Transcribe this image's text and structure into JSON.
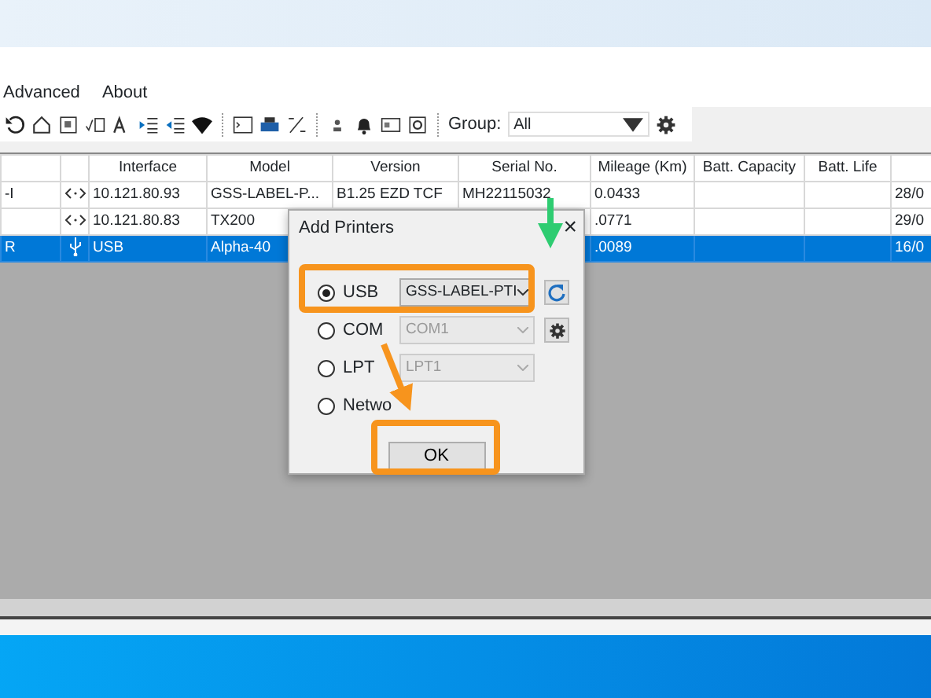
{
  "menu": [
    "Advanced",
    "About"
  ],
  "group": {
    "label": "Group:",
    "value": "All"
  },
  "table": {
    "columns": [
      "",
      "",
      "Interface",
      "Model",
      "Version",
      "Serial No.",
      "Mileage (Km)",
      "Batt. Capacity",
      "Batt. Life",
      ""
    ],
    "rows": [
      {
        "selected": false,
        "kind": "network",
        "cells": [
          "-I",
          "",
          "10.121.80.93",
          "GSS-LABEL-P...",
          "B1.25 EZD TCF",
          "MH22115032",
          "0.0433",
          "",
          "",
          "28/0"
        ]
      },
      {
        "selected": false,
        "kind": "network",
        "cells": [
          "",
          "",
          "10.121.80.83",
          "TX200",
          "",
          "",
          ".0771",
          "",
          "",
          "29/0"
        ]
      },
      {
        "selected": true,
        "kind": "usb",
        "cells": [
          "R",
          "",
          "USB",
          "Alpha-40",
          "",
          "",
          ".0089",
          "",
          "",
          "16/0"
        ]
      }
    ]
  },
  "dialog": {
    "title": "Add Printers",
    "close": "×",
    "ports": [
      {
        "label": "USB",
        "selected": true,
        "value": "GSS-LABEL-PTI",
        "disabled": false,
        "kind": "refresh"
      },
      {
        "label": "COM",
        "selected": false,
        "value": "COM1",
        "disabled": true,
        "kind": "settings"
      },
      {
        "label": "LPT",
        "selected": false,
        "value": "LPT1",
        "disabled": true,
        "kind": "plain"
      },
      {
        "label": "Netwo",
        "selected": false,
        "kind": "plain"
      }
    ],
    "ok": "OK"
  }
}
